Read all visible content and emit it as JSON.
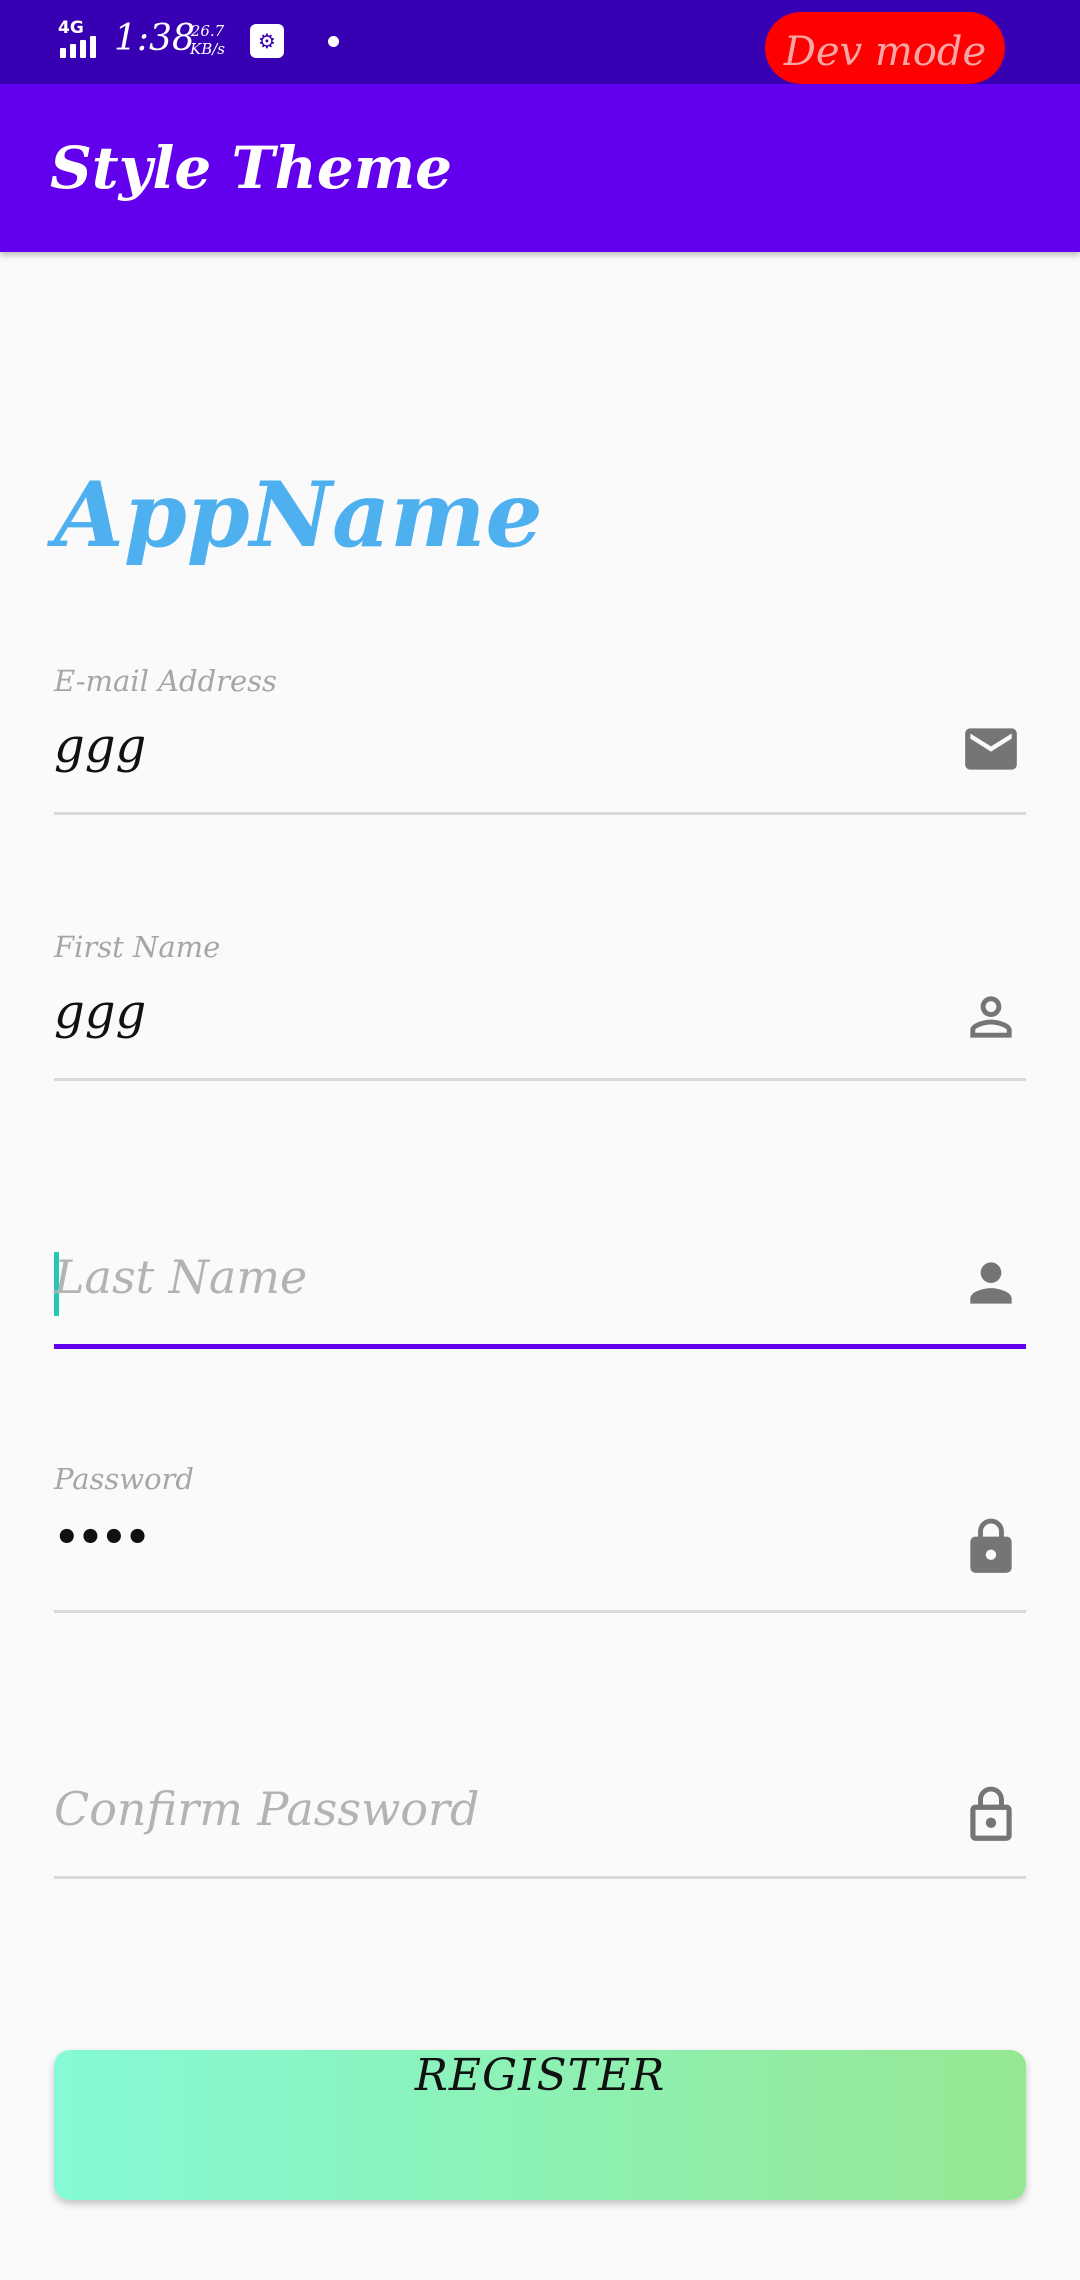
{
  "status_bar": {
    "network": "4G",
    "time": "1:38",
    "speed_value": "26.7",
    "speed_unit": "KB/s",
    "dev_mode": "Dev mode"
  },
  "app_bar": {
    "title": "Style Theme"
  },
  "brand": {
    "name": "AppName"
  },
  "form": {
    "email": {
      "label": "E-mail Address",
      "value": "ggg",
      "icon": "mail-icon"
    },
    "first_name": {
      "label": "First Name",
      "value": "ggg",
      "icon": "person-outline-icon"
    },
    "last_name": {
      "placeholder": "Last Name",
      "value": "",
      "icon": "person-icon",
      "focused": true
    },
    "password": {
      "label": "Password",
      "value": "••••",
      "icon": "lock-icon"
    },
    "confirm_password": {
      "placeholder": "Confirm Password",
      "value": "",
      "icon": "lock-outline-icon"
    }
  },
  "register_button": {
    "label": "REGISTER"
  },
  "colors": {
    "status_bar": "#3700b3",
    "app_bar": "#6200ee",
    "brand": "#4fb0f0",
    "focus_underline": "#6200ee",
    "cursor": "#26c6b9",
    "button_gradient_start": "#84fad6",
    "button_gradient_end": "#95e892",
    "dev_mode_badge": "#ff0000"
  }
}
